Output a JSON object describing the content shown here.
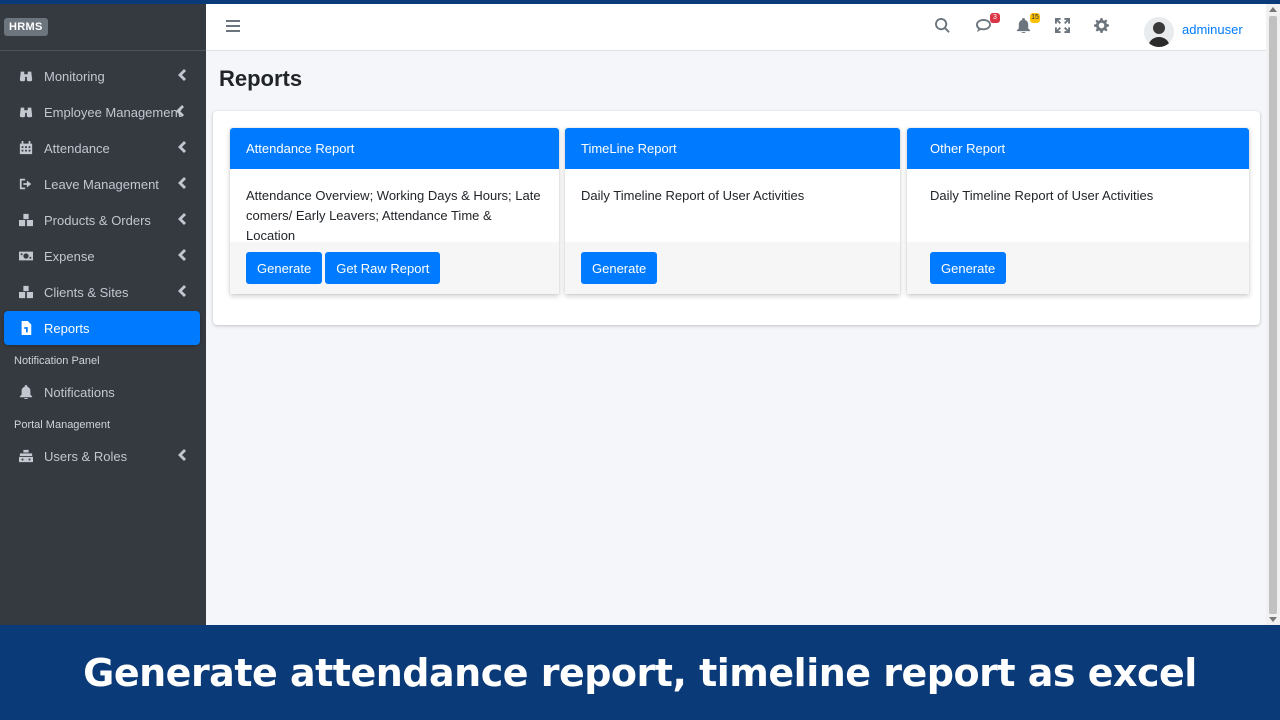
{
  "brand": {
    "label": "HRMS"
  },
  "sidebar": {
    "items": [
      {
        "label": "Monitoring",
        "icon": "binoculars-icon",
        "chevron": true
      },
      {
        "label": "Employee Management",
        "icon": "binoculars-icon",
        "chevron": true
      },
      {
        "label": "Attendance",
        "icon": "calendar-icon",
        "chevron": true
      },
      {
        "label": "Leave Management",
        "icon": "sign-out-icon",
        "chevron": true
      },
      {
        "label": "Products & Orders",
        "icon": "boxes-icon",
        "chevron": true
      },
      {
        "label": "Expense",
        "icon": "money-icon",
        "chevron": true
      },
      {
        "label": "Clients & Sites",
        "icon": "boxes-icon",
        "chevron": true
      },
      {
        "label": "Reports",
        "icon": "file-icon",
        "active": true
      }
    ],
    "section_notification": "Notification Panel",
    "notifications_label": "Notifications",
    "section_portal": "Portal Management",
    "users_roles_label": "Users & Roles"
  },
  "navbar": {
    "messages_badge": "3",
    "notifications_badge": "15",
    "username": "adminuser"
  },
  "page": {
    "title": "Reports"
  },
  "reports": [
    {
      "title": "Attendance Report",
      "description": "Attendance Overview; Working Days & Hours; Late comers/ Early Leavers; Attendance Time & Location",
      "generate_label": "Generate",
      "raw_label": "Get Raw Report"
    },
    {
      "title": "TimeLine Report",
      "description": "Daily Timeline Report of User Activities",
      "generate_label": "Generate"
    },
    {
      "title": "Other Report",
      "description": "Daily Timeline Report of User Activities",
      "generate_label": "Generate"
    }
  ],
  "banner": {
    "text": "Generate attendance report, timeline report as excel"
  },
  "colors": {
    "primary": "#007bff",
    "sidebar": "#343a40",
    "banner": "#0b3a78"
  }
}
